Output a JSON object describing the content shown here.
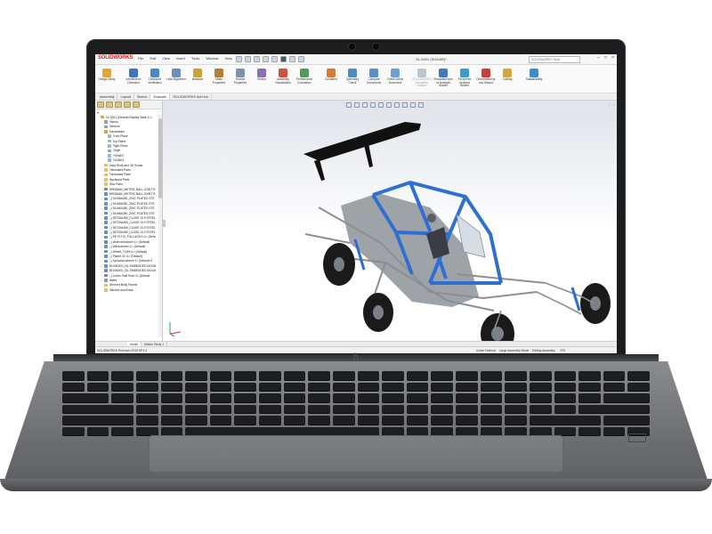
{
  "app": {
    "logo_text": "SOLIDWORKS",
    "document_title": "S1-0001 (SUGAR)*",
    "search_placeholder": "SOLIDWORKS Help",
    "window_controls": [
      "–",
      "□",
      "×"
    ]
  },
  "menu": [
    "File",
    "Edit",
    "View",
    "Insert",
    "Tools",
    "Window",
    "Help"
  ],
  "ribbon": {
    "commands": [
      {
        "label": "Design Study",
        "color": "#e3a43a",
        "enabled": true
      },
      {
        "label": "Interference Detection",
        "color": "#3d76c2",
        "enabled": true
      },
      {
        "label": "Clearance Verification",
        "color": "#4a86cc",
        "enabled": true
      },
      {
        "label": "Hole Alignment",
        "color": "#6a8fb8",
        "enabled": true
      },
      {
        "label": "Measure",
        "color": "#c9a236",
        "enabled": true
      },
      {
        "label": "Mass Properties",
        "color": "#b37e3a",
        "enabled": true
      },
      {
        "label": "Section Properties",
        "color": "#7d93ad",
        "enabled": true
      },
      {
        "label": "Sensor",
        "color": "#8c6fb0",
        "enabled": true
      },
      {
        "label": "Assembly Visualization",
        "color": "#d2513a",
        "enabled": true
      },
      {
        "label": "Performance Evaluation",
        "color": "#4f9d5a",
        "enabled": true
      },
      {
        "label": "Curvature",
        "color": "#d77a35",
        "enabled": true
      },
      {
        "label": "Symmetry Check",
        "color": "#4c8bc9",
        "enabled": true
      },
      {
        "label": "Compare Documents",
        "color": "#5b8fc7",
        "enabled": true
      },
      {
        "label": "Check Active Document",
        "color": "#6aa2d8",
        "enabled": true
      },
      {
        "label": "SOLIDWORKS Simulation Advisor",
        "color": "#bfc5cc",
        "enabled": false
      },
      {
        "label": "SimulationXpress Analysis Wizard",
        "color": "#3f7bc4",
        "enabled": true
      },
      {
        "label": "FloXpress Analysis Wizard",
        "color": "#3b9bd0",
        "enabled": true
      },
      {
        "label": "DriveWorksXpress Wizard",
        "color": "#cc3d3d",
        "enabled": true
      },
      {
        "label": "Costing",
        "color": "#d3a838",
        "enabled": true
      },
      {
        "label": "Sustainability",
        "color": "#3b8cc8",
        "enabled": true
      }
    ]
  },
  "tabs": [
    "Assembly",
    "Layout",
    "Sketch",
    "Evaluate",
    "SOLIDWORKS Add-Ins"
  ],
  "active_tab": "Evaluate",
  "feature_tree": {
    "rows": [
      {
        "label": "S1-0001 (Default<Display State 1>)",
        "color": "#d8a640",
        "indent": 0
      },
      {
        "label": "History",
        "color": "#8a9fb5",
        "indent": 1
      },
      {
        "label": "Sensors",
        "color": "#8a9fb5",
        "indent": 1
      },
      {
        "label": "Annotations",
        "color": "#d2a54a",
        "indent": 1
      },
      {
        "label": "Front Plane",
        "color": "#9bb7d4",
        "indent": 2
      },
      {
        "label": "Top Plane",
        "color": "#9bb7d4",
        "indent": 2
      },
      {
        "label": "Right Plane",
        "color": "#9bb7d4",
        "indent": 2
      },
      {
        "label": "Origin",
        "color": "#9aa0a6",
        "indent": 2
      },
      {
        "label": "PLANE2",
        "color": "#9bb7d4",
        "indent": 2
      },
      {
        "label": "PLANE4",
        "color": "#9bb7d4",
        "indent": 2
      },
      {
        "label": "Body Work and 3D Scans",
        "color": "#e0c26a",
        "indent": 1
      },
      {
        "label": "Fabricated Parts",
        "color": "#e0c26a",
        "indent": 1
      },
      {
        "label": "Purchased Parts",
        "color": "#e0c26a",
        "indent": 1
      },
      {
        "label": "Machined Parts",
        "color": "#e0c26a",
        "indent": 1
      },
      {
        "label": "Misc Parts",
        "color": "#e0c26a",
        "indent": 1
      },
      {
        "label": "59935A84_METRIC BALL JOINT R",
        "color": "#6a8fc2",
        "indent": 1
      },
      {
        "label": "59935A84_METRIC BALL JOINT R",
        "color": "#6a8fc2",
        "indent": 1
      },
      {
        "label": "(-) 91166A280_ZINC PLATED STE",
        "color": "#6a8fc2",
        "indent": 1
      },
      {
        "label": "(-) 91166A280_ZINC PLATED STE",
        "color": "#6a8fc2",
        "indent": 1
      },
      {
        "label": "(-) 91166A280_ZINC PLATED STE",
        "color": "#6a8fc2",
        "indent": 1
      },
      {
        "label": "(-) 91166A280_ZINC PLATED STE",
        "color": "#6a8fc2",
        "indent": 1
      },
      {
        "label": "(-) 93725A455_CLASS 10.9 STEEL",
        "color": "#6a8fc2",
        "indent": 1
      },
      {
        "label": "(-) 93725A455_CLASS 10.9 STEEL",
        "color": "#6a8fc2",
        "indent": 1
      },
      {
        "label": "(-) 93725A455_CLASS 10.9 STEEL",
        "color": "#6a8fc2",
        "indent": 1
      },
      {
        "label": "(-) 93725A455_CLASS 10.9 STEEL",
        "color": "#6a8fc2",
        "indent": 1
      },
      {
        "label": "(-) PE FLT-B_FULL ASSY<1> (Defa",
        "color": "#6a8fc2",
        "indent": 1
      },
      {
        "label": "(-) chain tensioner<1> (Default)",
        "color": "#6a8fc2",
        "indent": 1
      },
      {
        "label": "(-) Windscreen<1> (Default)",
        "color": "#6a8fc2",
        "indent": 1
      },
      {
        "label": "(-) Wheel_T16H<1> (Default)",
        "color": "#6a8fc2",
        "indent": 1
      },
      {
        "label": "(-) Planet 01<1> (Default)",
        "color": "#6a8fc2",
        "indent": 1
      },
      {
        "label": "(-) Sprocket-wheel<1> (Default<1",
        "color": "#6a8fc2",
        "indent": 1
      },
      {
        "label": "5910N300_OIL EMBEDDED MOUN",
        "color": "#6a8fc2",
        "indent": 1
      },
      {
        "label": "5910N300_OIL EMBEDDED MOUN",
        "color": "#6a8fc2",
        "indent": 1
      },
      {
        "label": "(-) Lower Shift Rod<1> (Default",
        "color": "#6a8fc2",
        "indent": 1
      },
      {
        "label": "Mates",
        "color": "#8a9fb5",
        "indent": 1
      },
      {
        "label": "Mirrored Body Panels",
        "color": "#e0c26a",
        "indent": 1
      },
      {
        "label": "Stitches and Bows",
        "color": "#e0c26a",
        "indent": 1
      }
    ]
  },
  "bottom_tabs": [
    "Model",
    "Motion Study 1"
  ],
  "status": {
    "left": "SOLIDWORKS Premium 2019 SP1.0",
    "right_items": [
      "Under Defined",
      "Large Assembly Mode",
      "Editing Assembly",
      "IPS"
    ]
  },
  "model": {
    "frame_color": "#2e6fd1",
    "panel_color": "#9ea3a8",
    "tube_color": "#8b8f94",
    "tire_color": "#1a1a1a",
    "wing_color": "#111111",
    "accent_blue": "#2d6cd3"
  }
}
